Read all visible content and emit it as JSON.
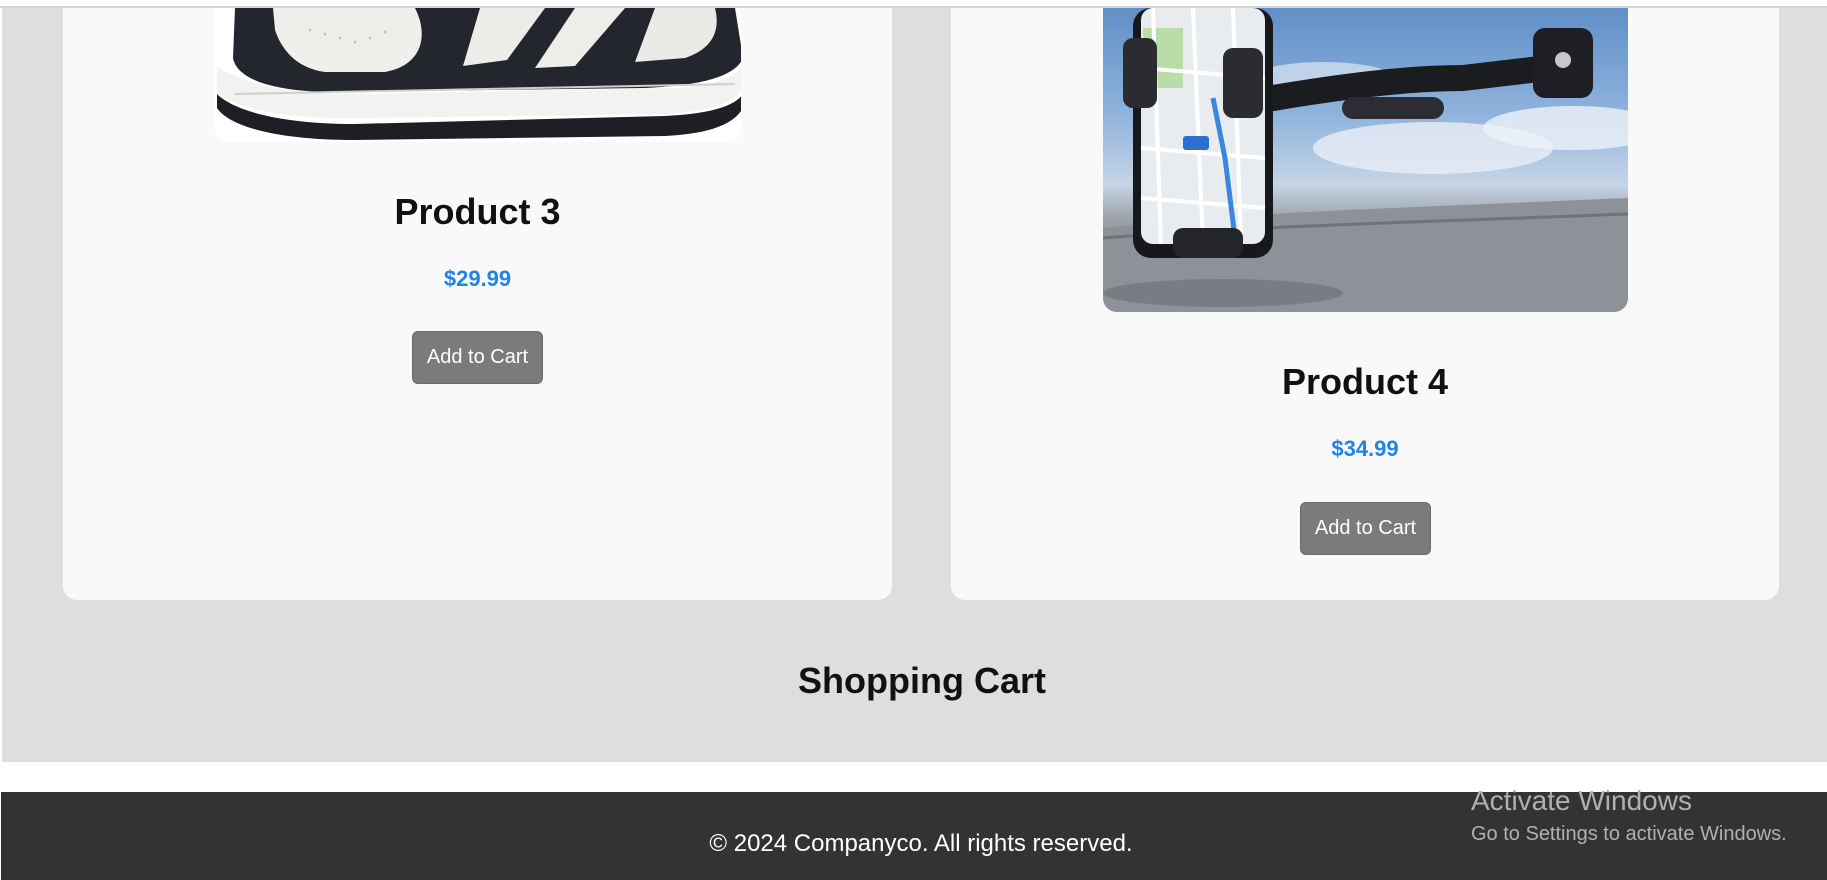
{
  "products": [
    {
      "name": "Product 3",
      "price": "$29.99",
      "button_label": "Add to Cart",
      "image_alt": "High-top sneaker"
    },
    {
      "name": "Product 4",
      "price": "$34.99",
      "button_label": "Add to Cart",
      "image_alt": "Car phone mount with map on phone"
    }
  ],
  "cart": {
    "heading": "Shopping Cart"
  },
  "footer": {
    "text": "© 2024 Companyco. All rights reserved."
  },
  "watermark": {
    "title": "Activate Windows",
    "subtitle": "Go to Settings to activate Windows."
  },
  "colors": {
    "accent_price": "#1f84e6",
    "button_bg": "#7b7b7b",
    "page_bg": "#dedede",
    "card_bg": "#f9f9f9",
    "footer_bg": "#333333"
  }
}
